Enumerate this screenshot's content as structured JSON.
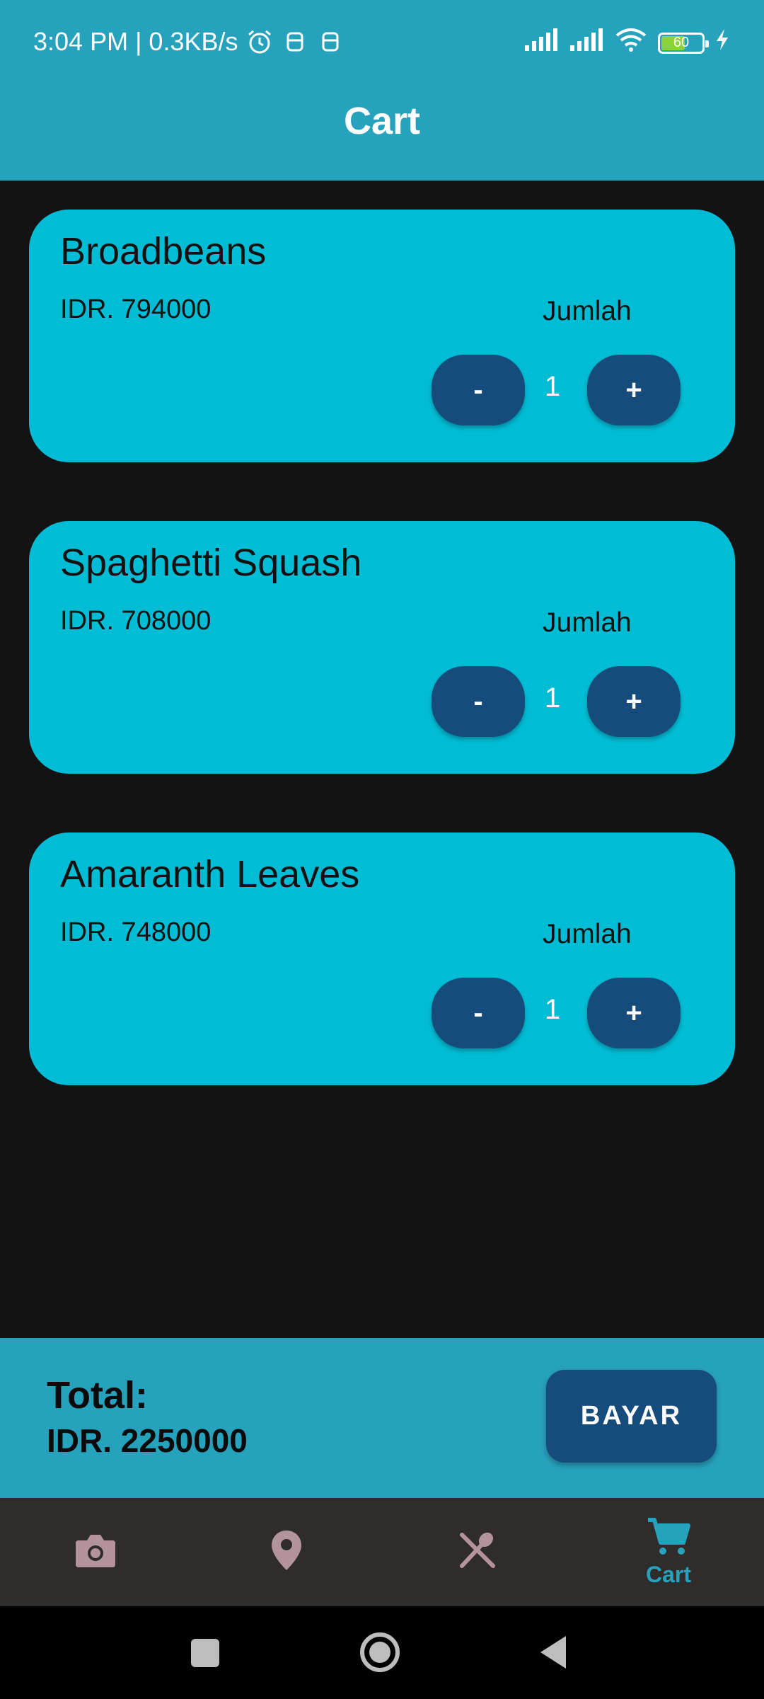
{
  "status_bar": {
    "time_speed": "3:04 PM | 0.3KB/s",
    "battery": "60",
    "icons": [
      "alarm-icon",
      "notification-icon",
      "notification-icon",
      "signal-icon",
      "signal-icon",
      "wifi-icon",
      "battery-icon",
      "charging-icon"
    ]
  },
  "app_bar": {
    "title": "Cart"
  },
  "cart": {
    "items": [
      {
        "name": "Broadbeans",
        "price": "IDR. 794000",
        "qty_label": "Jumlah",
        "minus": "-",
        "qty": "1",
        "plus": "+"
      },
      {
        "name": "Spaghetti Squash",
        "price": "IDR. 708000",
        "qty_label": "Jumlah",
        "minus": "-",
        "qty": "1",
        "plus": "+"
      },
      {
        "name": "Amaranth Leaves",
        "price": "IDR. 748000",
        "qty_label": "Jumlah",
        "minus": "-",
        "qty": "1",
        "plus": "+"
      }
    ]
  },
  "total": {
    "label": "Total:",
    "value": "IDR. 2250000",
    "pay_label": "BAYAR"
  },
  "bottom_nav": {
    "items": [
      {
        "icon": "camera-icon",
        "label": ""
      },
      {
        "icon": "location-pin-icon",
        "label": ""
      },
      {
        "icon": "utensils-icon",
        "label": ""
      },
      {
        "icon": "cart-icon",
        "label": "Cart"
      }
    ],
    "active_index": 3
  },
  "colors": {
    "primary": "#27a2bd",
    "card": "#00bcd5",
    "button": "#164c7c",
    "background": "#131313",
    "nav_inactive": "#b3949a"
  }
}
